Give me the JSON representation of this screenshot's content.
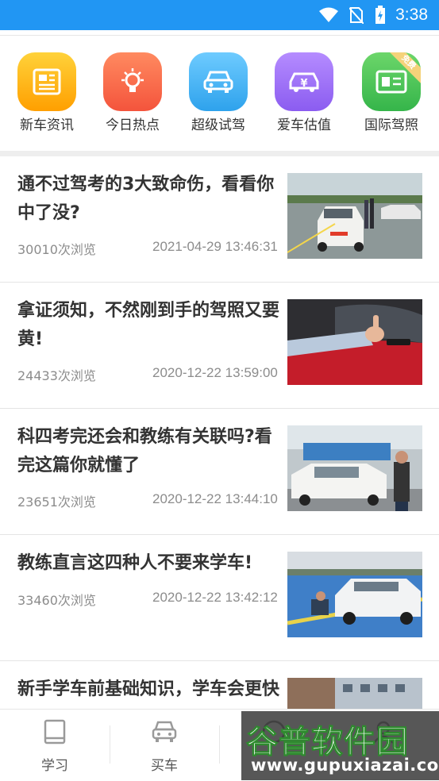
{
  "status_bar": {
    "time": "3:38",
    "background": "#2196f3"
  },
  "quick_links": [
    {
      "label": "新车资讯",
      "icon": "newspaper-icon",
      "color": "#ffb300"
    },
    {
      "label": "今日热点",
      "icon": "lightbulb-icon",
      "color": "#ff6f4f"
    },
    {
      "label": "超级试驾",
      "icon": "car-icon",
      "color": "#3fb6f5"
    },
    {
      "label": "爱车估值",
      "icon": "car-price-icon",
      "color": "#9b6cf7"
    },
    {
      "label": "国际驾照",
      "icon": "license-icon",
      "color": "#4cc35a",
      "badge": "免费"
    }
  ],
  "news": [
    {
      "title": "通不过驾考的3大致命伤，看看你中了没?",
      "views": "30010次浏览",
      "date": "2021-04-29 13:46:31"
    },
    {
      "title": "拿证须知，不然刚到手的驾照又要黄!",
      "views": "24433次浏览",
      "date": "2020-12-22 13:59:00"
    },
    {
      "title": "科四考完还会和教练有关联吗?看完这篇你就懂了",
      "views": "23651次浏览",
      "date": "2020-12-22 13:44:10"
    },
    {
      "title": "教练直言这四种人不要来学车!",
      "views": "33460次浏览",
      "date": "2020-12-22 13:42:12"
    },
    {
      "title": "新手学车前基础知识，学车会更快",
      "views": "",
      "date": ""
    }
  ],
  "bottom_nav": [
    {
      "label": "学习",
      "icon": "book-icon"
    },
    {
      "label": "买车",
      "icon": "car-outline-icon"
    },
    {
      "label": "",
      "icon": "compass-icon"
    },
    {
      "label": "",
      "icon": "user-icon"
    }
  ],
  "watermark": {
    "title": "谷普软件园",
    "url": "www.gupuxiazai.com"
  }
}
